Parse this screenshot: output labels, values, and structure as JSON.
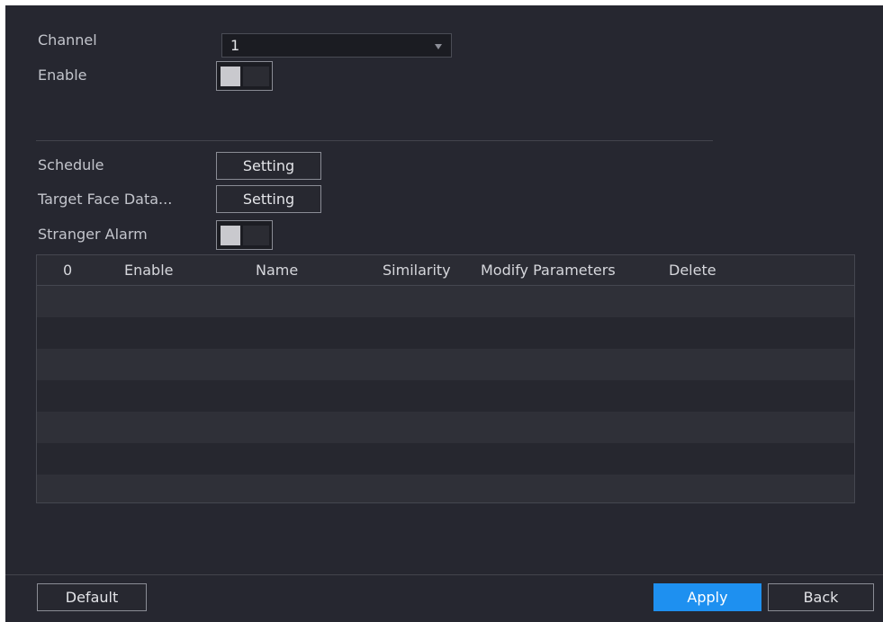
{
  "form": {
    "channel_label": "Channel",
    "channel_value": "1",
    "enable_label": "Enable",
    "enable_on": false,
    "schedule_label": "Schedule",
    "schedule_button": "Setting",
    "target_face_label": "Target Face Data...",
    "target_face_button": "Setting",
    "stranger_alarm_label": "Stranger Alarm",
    "stranger_alarm_on": false
  },
  "table": {
    "columns": [
      "0",
      "Enable",
      "Name",
      "Similarity",
      "Modify Parameters",
      "Delete"
    ],
    "rows": []
  },
  "footer": {
    "default_label": "Default",
    "apply_label": "Apply",
    "back_label": "Back"
  },
  "colors": {
    "background": "#262730",
    "accent": "#1e90f0",
    "text": "#c3c5cc"
  }
}
